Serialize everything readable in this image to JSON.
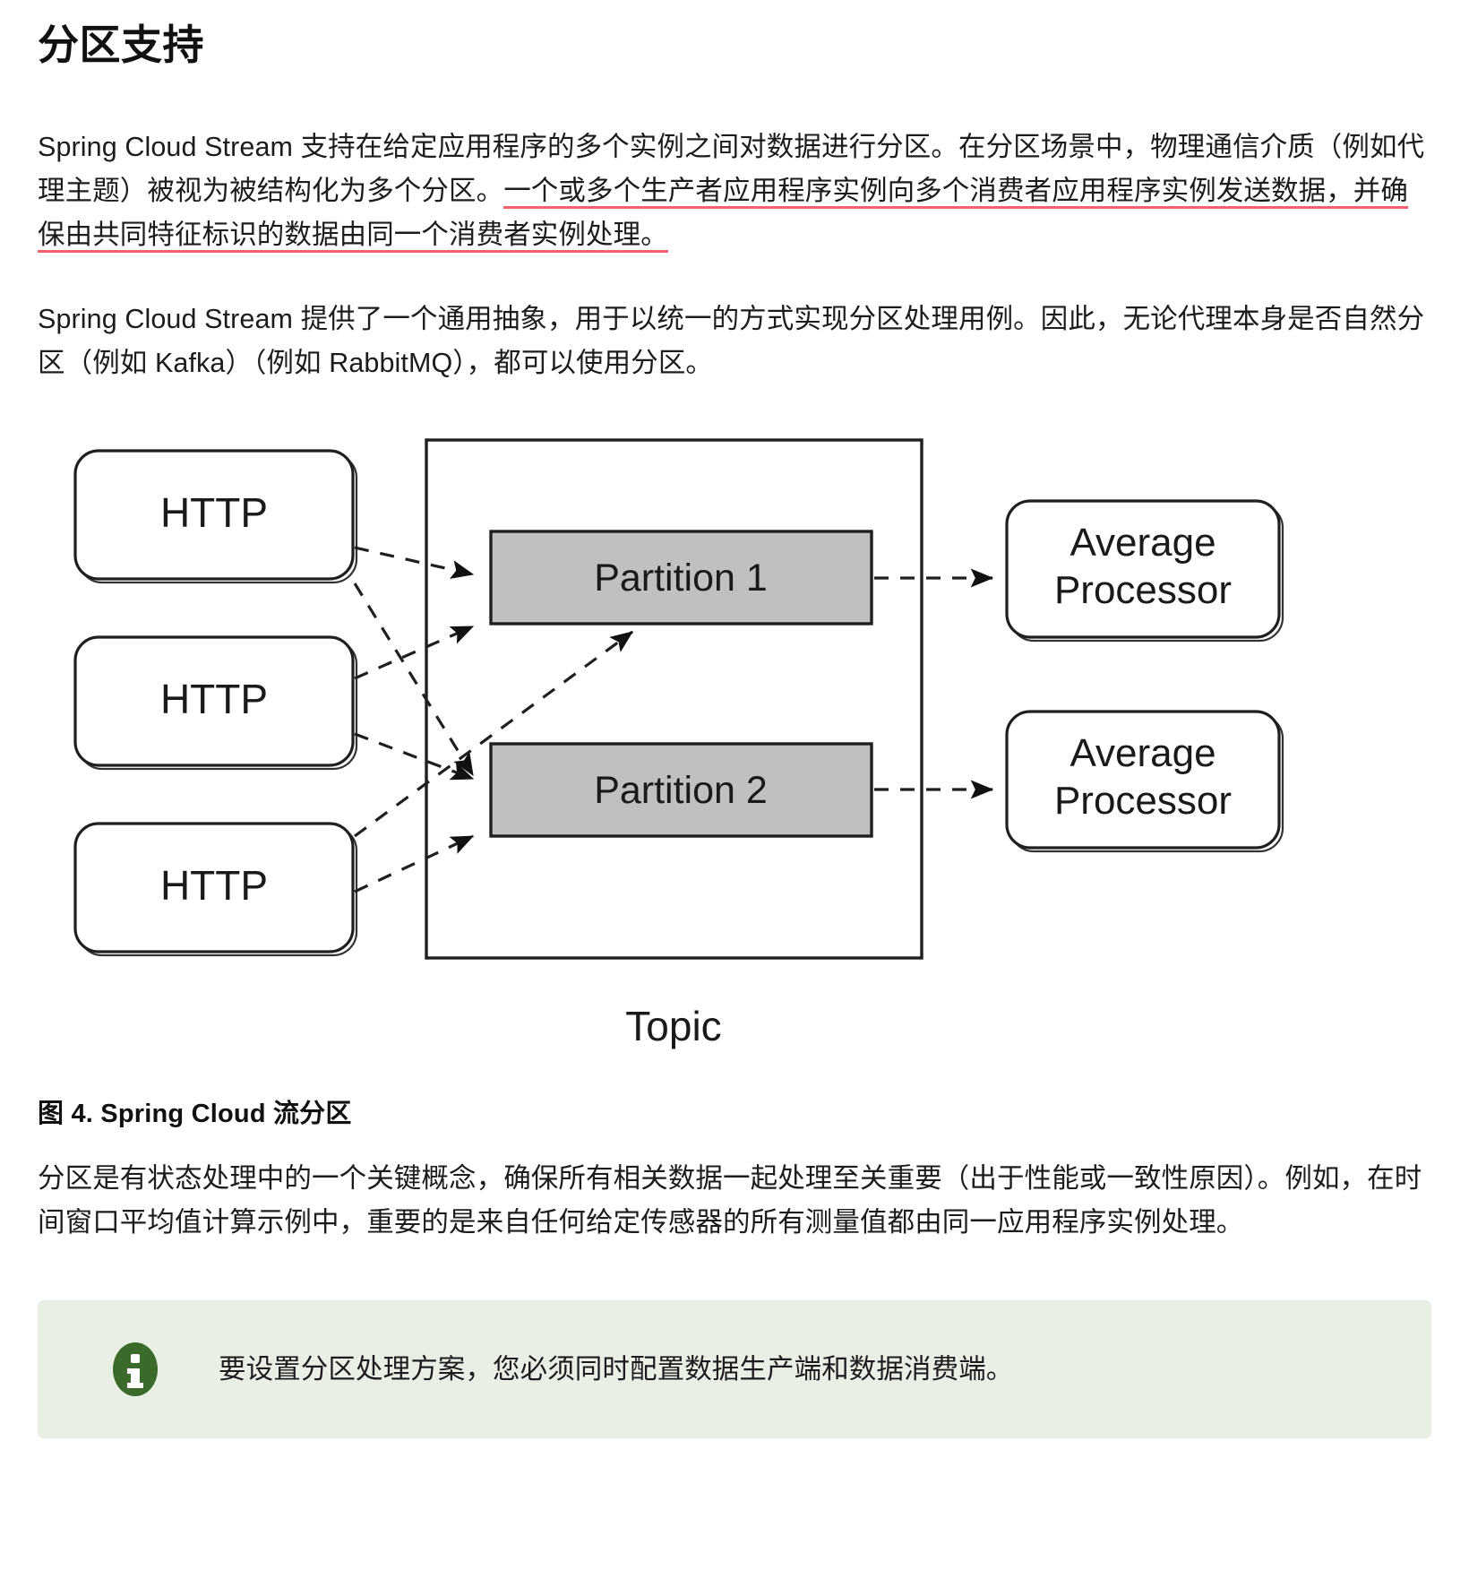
{
  "heading": "分区支持",
  "paragraphs": {
    "p1_plain_a": "Spring Cloud Stream 支持在给定应用程序的多个实例之间对数据进行分区。在分区场景中，物理通信介质（例如代理主题）被视为被结构化为多个分区。",
    "p1_highlighted": "一个或多个生产者应用程序实例向多个消费者应用程序实例发送数据，并确保由共同特征标识的数据由同一个消费者实例处理。",
    "p2": "Spring Cloud Stream 提供了一个通用抽象，用于以统一的方式实现分区处理用例。因此，无论代理本身是否自然分区（例如 Kafka）（例如 RabbitMQ），都可以使用分区。",
    "p3": "分区是有状态处理中的一个关键概念，确保所有相关数据一起处理至关重要（出于性能或一致性原因）。例如，在时间窗口平均值计算示例中，重要的是来自任何给定传感器的所有测量值都由同一应用程序实例处理。"
  },
  "figure": {
    "caption": "图 4. Spring Cloud 流分区",
    "producers": [
      "HTTP",
      "HTTP",
      "HTTP"
    ],
    "partitions": [
      "Partition 1",
      "Partition 2"
    ],
    "consumers": [
      "Average\nProcessor",
      "Average\nProcessor"
    ],
    "consumer_lines": [
      [
        "Average",
        "Processor"
      ],
      [
        "Average",
        "Processor"
      ]
    ],
    "topic_label": "Topic"
  },
  "admonition": {
    "icon": "info-icon",
    "text": "要设置分区处理方案，您必须同时配置数据生产端和数据消费端。",
    "bg_color": "#e9efe5",
    "icon_color": "#3a6b2a"
  },
  "colors": {
    "highlight": "#f4616e",
    "partition_fill": "#c0c0c0",
    "stroke": "#1f1f1f",
    "text": "#1c1c1c"
  }
}
